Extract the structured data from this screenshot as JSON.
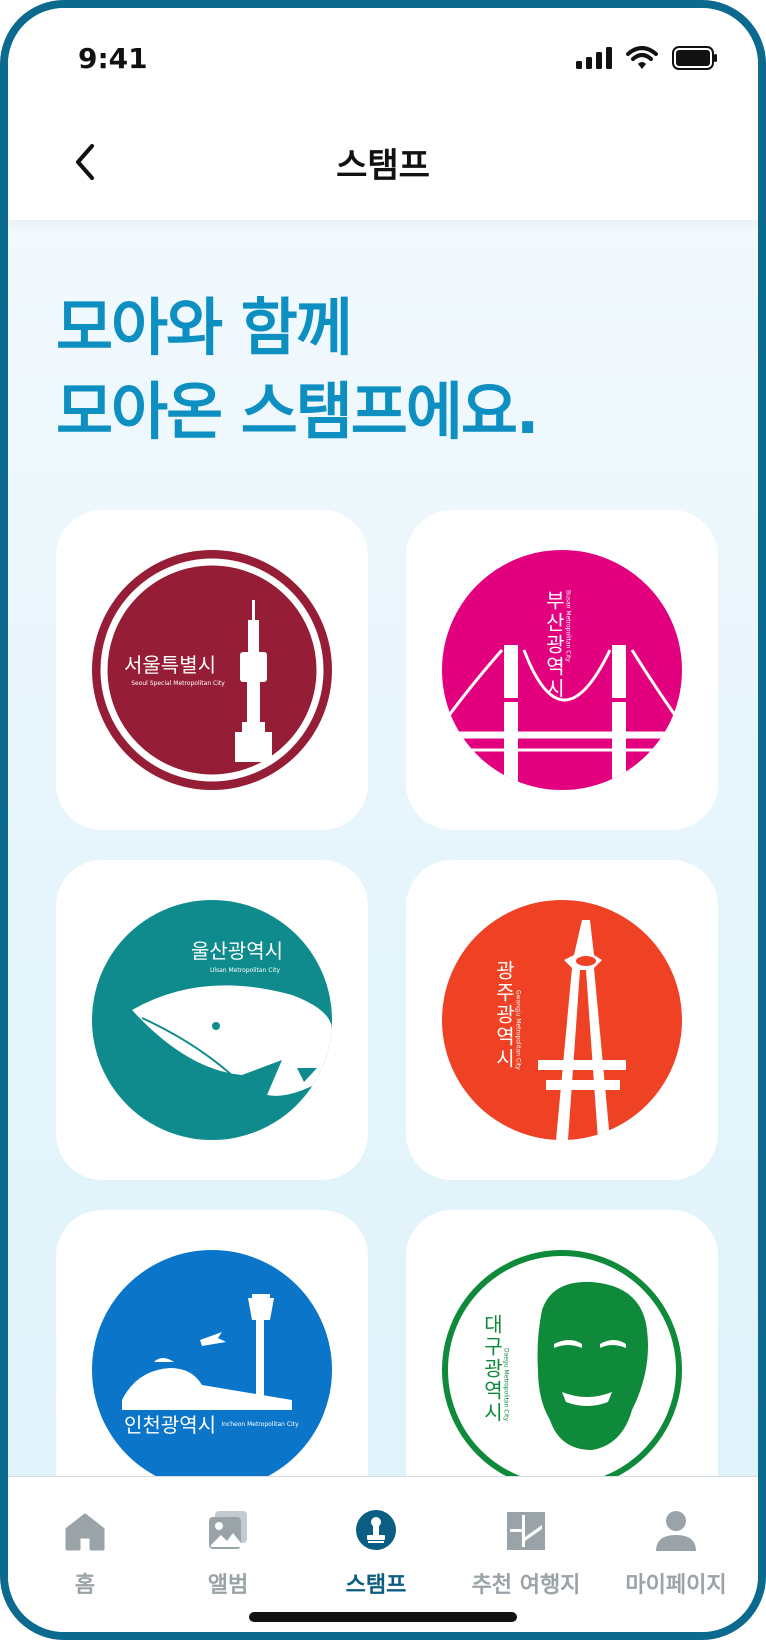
{
  "status": {
    "time": "9:41"
  },
  "header": {
    "title": "스탬프"
  },
  "headline": {
    "line1": "모아와 함께",
    "line2": "모아온 스탬프에요."
  },
  "stamps": [
    {
      "name_ko": "서울특별시",
      "name_en": "Seoul Special Metropolitan City",
      "color": "#951d36"
    },
    {
      "name_ko": "부산광역시",
      "name_en": "Busan Metropolitan City",
      "color": "#e3007f"
    },
    {
      "name_ko": "울산광역시",
      "name_en": "Ulsan Metropolitan City",
      "color": "#0f8b8d"
    },
    {
      "name_ko": "광주광역시",
      "name_en": "Gwangju Metropolitan City",
      "color": "#ef4123"
    },
    {
      "name_ko": "인천광역시",
      "name_en": "Incheon Metropolitan City",
      "color": "#0b75c9"
    },
    {
      "name_ko": "대구광역시",
      "name_en": "Daegu Metropolitan City",
      "color": "#0e8a3a"
    }
  ],
  "tabs": [
    {
      "label": "홈",
      "icon": "home-icon"
    },
    {
      "label": "앨범",
      "icon": "album-icon"
    },
    {
      "label": "스탬프",
      "icon": "stamp-icon",
      "active": true
    },
    {
      "label": "추천 여행지",
      "icon": "map-icon"
    },
    {
      "label": "마이페이지",
      "icon": "person-icon"
    }
  ],
  "colors": {
    "accent": "#0d8fc1",
    "frame": "#0b6a8e",
    "tab_active": "#0b5d82",
    "tab_inactive": "#9aa3a8"
  }
}
